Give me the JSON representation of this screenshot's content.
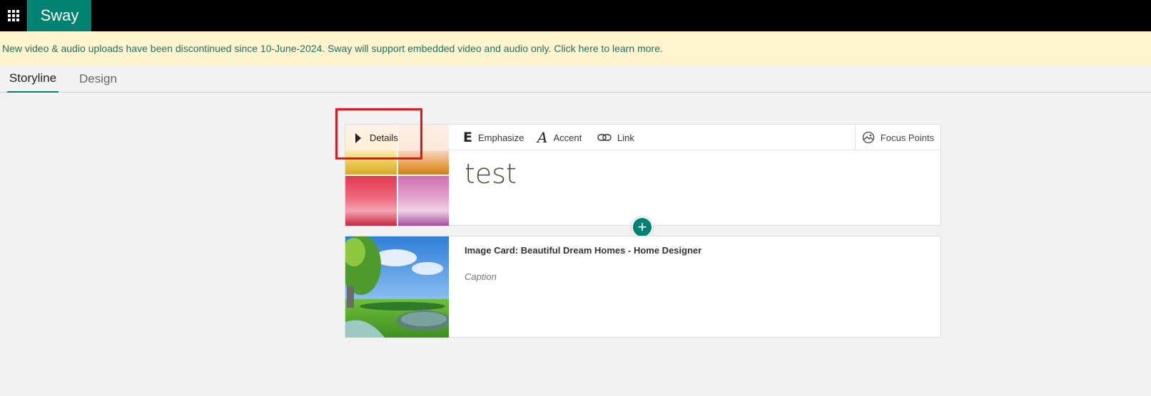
{
  "app": {
    "title": "Sway",
    "menu_icon": "app-launcher-waffle-icon"
  },
  "notice": {
    "text": "New video & audio uploads have been discontinued since 10-June-2024. Sway will support embedded video and audio only. Click here to learn more."
  },
  "tabs": [
    {
      "label": "Storyline",
      "active": true
    },
    {
      "label": "Design",
      "active": false
    }
  ],
  "heading_card": {
    "details_label": "Details",
    "toolbar": {
      "emphasize": {
        "icon_letter": "E",
        "label": "Emphasize"
      },
      "accent": {
        "icon_letter": "A",
        "label": "Accent"
      },
      "link": {
        "label": "Link"
      },
      "focus_points": {
        "label": "Focus Points"
      }
    },
    "text": "test"
  },
  "add_card": {
    "symbol": "+"
  },
  "image_card": {
    "title": "Image Card: Beautiful Dream Homes - Home Designer",
    "caption_placeholder": "Caption"
  },
  "colors": {
    "accent": "#008272",
    "banner_bg": "#fff4ce",
    "highlight": "#e0161b"
  }
}
